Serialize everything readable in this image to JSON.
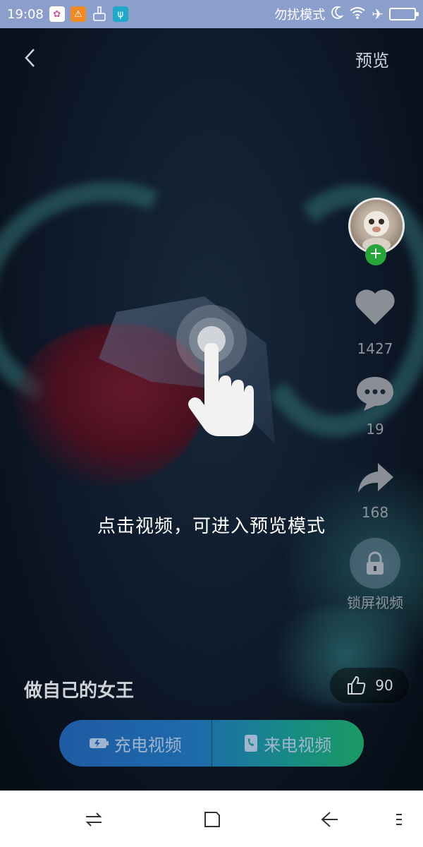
{
  "status_bar": {
    "time": "19:08",
    "mode_text": "勿扰模式",
    "icons": [
      "app-notification-icon",
      "warning-icon",
      "brush-icon",
      "usb-icon",
      "moon-icon",
      "wifi-icon",
      "airplane-icon",
      "battery-icon"
    ]
  },
  "header": {
    "back_icon": "chevron-left-icon",
    "preview_label": "预览"
  },
  "side_actions": {
    "follow_icon": "plus-icon",
    "like_count": "1427",
    "comment_count": "19",
    "share_count": "168",
    "lock_screen_label": "锁屏视频"
  },
  "hint": {
    "text": "点击视频，可进入预览模式",
    "icon": "tap-hand-icon"
  },
  "video": {
    "title": "做自己的女王",
    "thumbs_up_count": "90"
  },
  "action_bar": {
    "charge_video_label": "充电视频",
    "call_video_label": "来电视频"
  },
  "colors": {
    "status_bar": "#8c9fcc",
    "follow_green": "#27a53a",
    "action_gradient_start": "#1f5aa3",
    "action_gradient_end": "#1a9a62"
  }
}
